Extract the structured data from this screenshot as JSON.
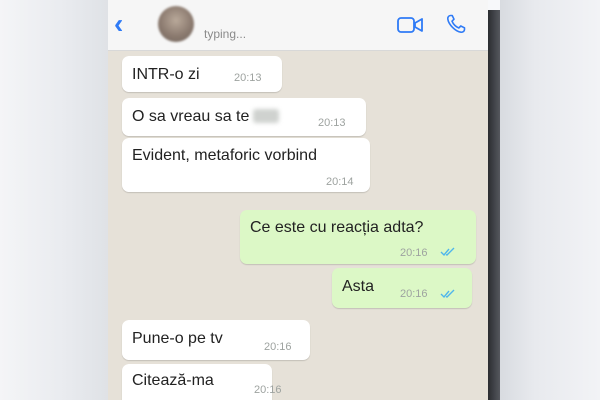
{
  "header": {
    "back_glyph": "‹",
    "contact_name": "",
    "status": "typing...",
    "icons": [
      "back-arrow-icon",
      "avatar",
      "video-call-icon",
      "phone-call-icon"
    ]
  },
  "colors": {
    "incoming_bubble": "#ffffff",
    "outgoing_bubble": "#dcf8c6",
    "chat_background": "#e6e1d8",
    "accent": "#2f7bf6",
    "read_ticks": "#4fb6ec"
  },
  "messages": [
    {
      "direction": "in",
      "text": "INTR-o zi",
      "time": "20:13"
    },
    {
      "direction": "in",
      "text": "O sa vreau sa te",
      "time": "20:13",
      "redacted_word": true
    },
    {
      "direction": "in",
      "text": "Evident, metaforic vorbind",
      "time": "20:14"
    },
    {
      "direction": "out",
      "text": "Ce este cu reacția adta?",
      "time": "20:16",
      "read": true
    },
    {
      "direction": "out",
      "text": "Asta",
      "time": "20:16",
      "read": true
    },
    {
      "direction": "in",
      "text": "Pune-o pe tv",
      "time": "20:16"
    },
    {
      "direction": "in",
      "text": "Citează-ma",
      "time": "20:16"
    }
  ]
}
